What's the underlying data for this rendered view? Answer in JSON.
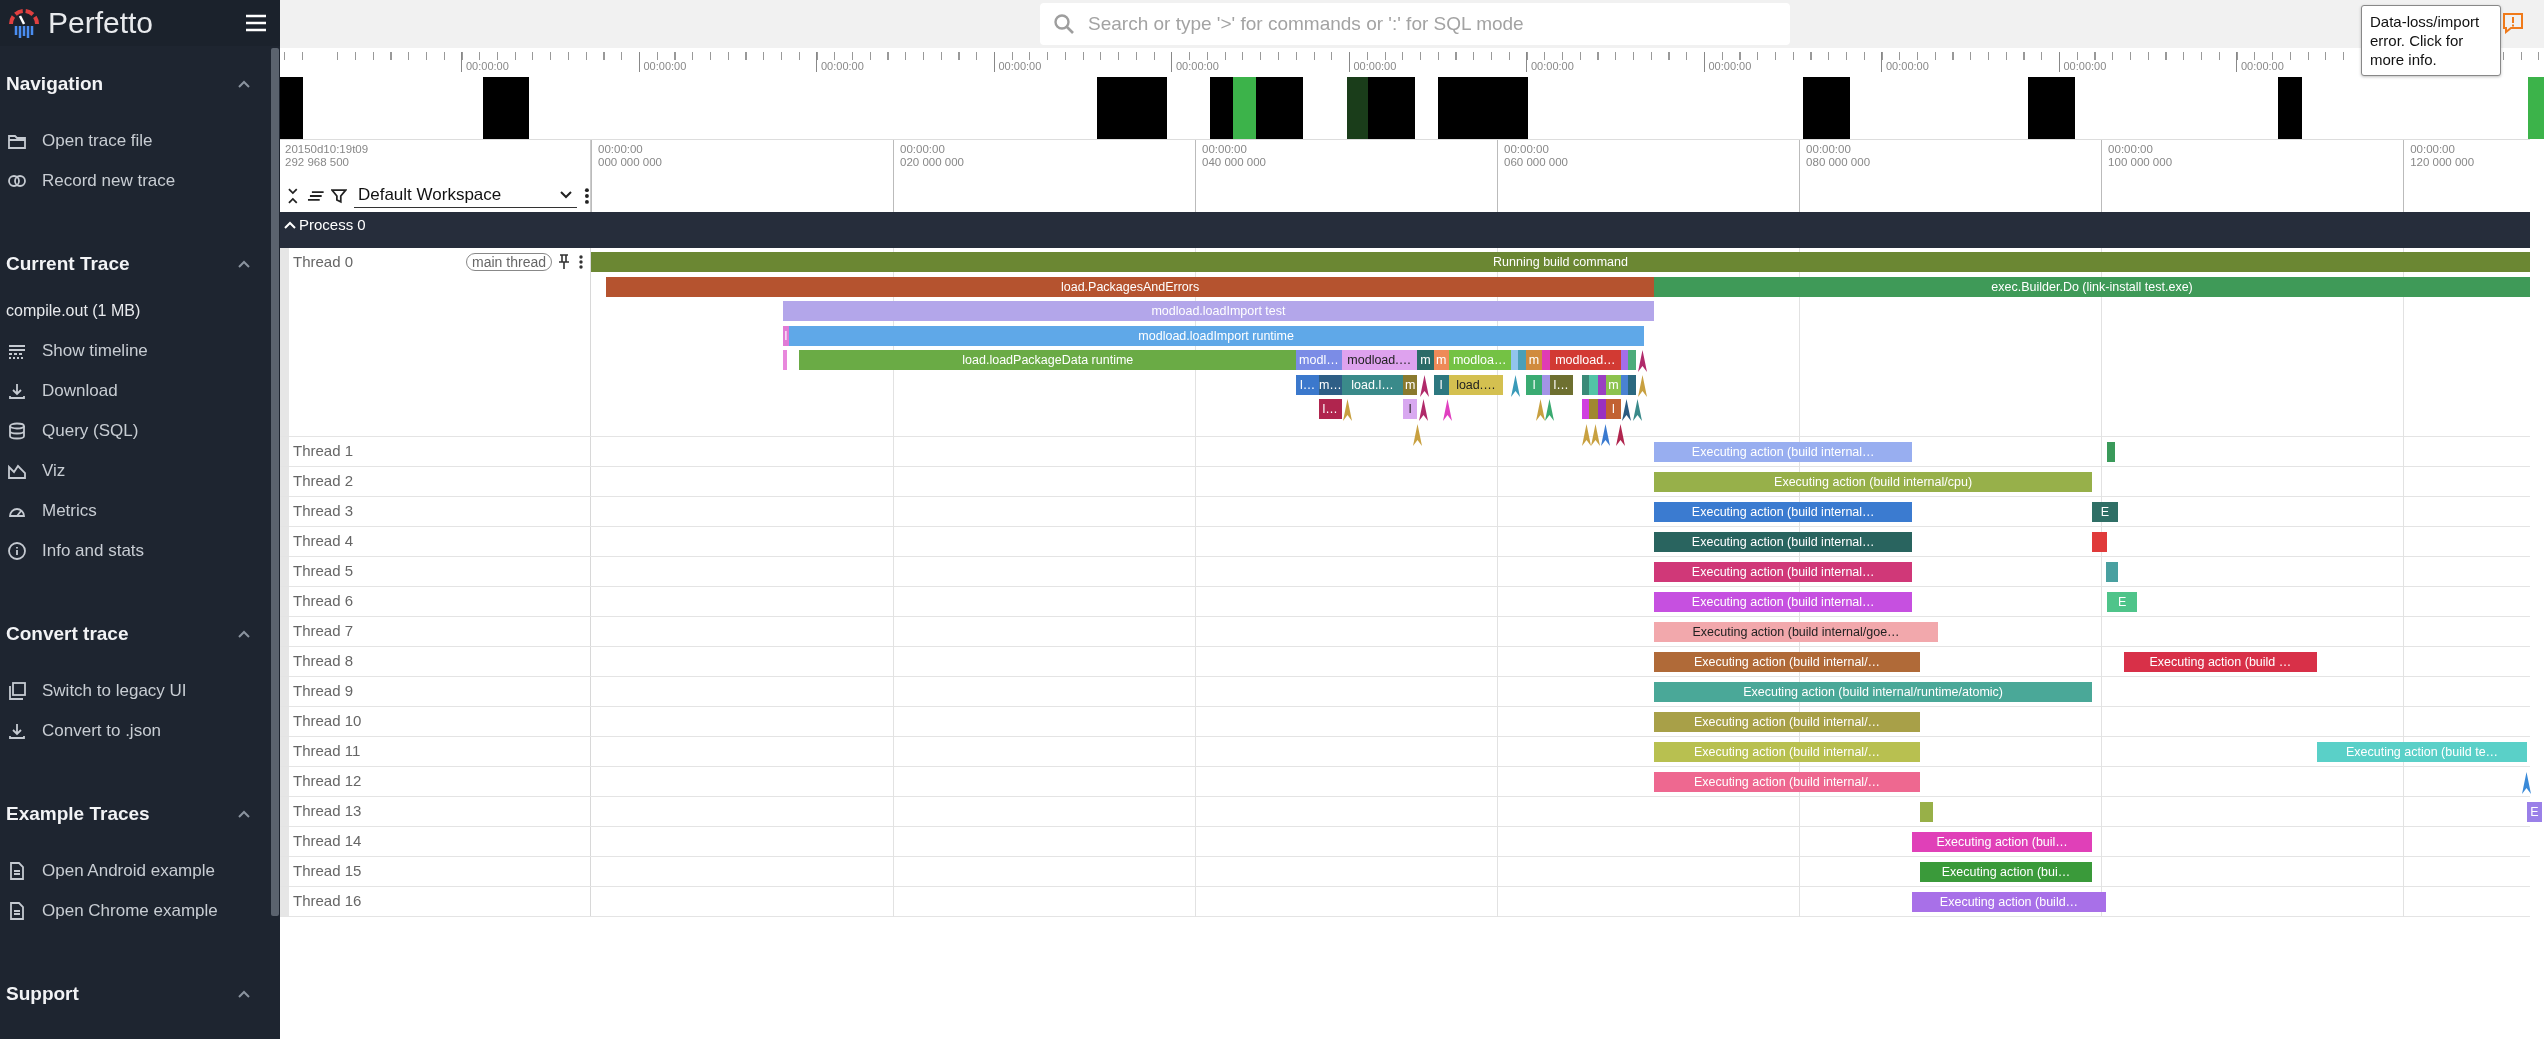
{
  "sidebar": {
    "title": "Perfetto",
    "sections": [
      {
        "title": "Navigation",
        "expanded": true,
        "items": [
          {
            "kind": "link",
            "label": "Open trace file"
          },
          {
            "kind": "link",
            "label": "Record new trace"
          }
        ]
      },
      {
        "title": "Current Trace",
        "expanded": true,
        "items": [
          {
            "kind": "text",
            "label": "compile.out (1 MB)"
          },
          {
            "kind": "link",
            "label": "Show timeline"
          },
          {
            "kind": "link",
            "label": "Download"
          },
          {
            "kind": "link",
            "label": "Query (SQL)"
          },
          {
            "kind": "link",
            "label": "Viz"
          },
          {
            "kind": "link",
            "label": "Metrics"
          },
          {
            "kind": "link",
            "label": "Info and stats"
          }
        ]
      },
      {
        "title": "Convert trace",
        "expanded": true,
        "items": [
          {
            "kind": "link",
            "label": "Switch to legacy UI"
          },
          {
            "kind": "link",
            "label": "Convert to .json"
          }
        ]
      },
      {
        "title": "Example Traces",
        "expanded": true,
        "items": [
          {
            "kind": "link",
            "label": "Open Android example"
          },
          {
            "kind": "link",
            "label": "Open Chrome example"
          }
        ]
      },
      {
        "title": "Support",
        "expanded": true
      }
    ]
  },
  "topbar": {
    "search": {
      "placeholder": "Search or type '>' for commands or ':' for SQL mode"
    },
    "error_tooltip": {
      "text": "Data-loss/import error. Click for more info."
    }
  },
  "overview": {
    "tick_labels": [
      "00:00:00",
      "00:00:00",
      "00:00:00",
      "00:00:00",
      "00:00:00",
      "00:00:00",
      "00:00:00",
      "00:00:00",
      "00:00:00",
      "00:00:00",
      "00:00:00"
    ]
  },
  "timeline": {
    "start_label": "20150d10:19t09",
    "start_offset": "292 968 500",
    "ticks": [
      {
        "time": "00:00:00",
        "offset": "000 000 000"
      },
      {
        "time": "00:00:00",
        "offset": "020 000 000"
      },
      {
        "time": "00:00:00",
        "offset": "040 000 000"
      },
      {
        "time": "00:00:00",
        "offset": "060 000 000"
      },
      {
        "time": "00:00:00",
        "offset": "080 000 000"
      },
      {
        "time": "00:00:00",
        "offset": "100 000 000"
      },
      {
        "time": "00:00:00",
        "offset": "120 000 000"
      }
    ]
  },
  "workspace": {
    "name": "Default Workspace"
  },
  "process": {
    "name": "Process 0",
    "expanded": true
  },
  "threads": [
    {
      "name": "Thread 0",
      "tag": "main thread",
      "rows": [
        {
          "slices": [
            {
              "name": "Running build command",
              "color": "#6b8733"
            }
          ]
        },
        {
          "slices": [
            {
              "name": "load.PackagesAndErrors",
              "color": "#b5532f"
            },
            {
              "name": "exec.Builder.Do (link-install test.exe)",
              "color": "#3f9a58"
            }
          ]
        },
        {
          "slices": [
            {
              "name": "modload.loadImport test",
              "color": "#b3a6ea"
            }
          ]
        },
        {
          "slices": [
            {
              "name": "l",
              "color": "#e07bd6"
            },
            {
              "name": "modload.loadImport runtime",
              "color": "#5fa8e8"
            }
          ]
        },
        {
          "slices": [
            {
              "color": "#e888dc"
            },
            {
              "name": "load.loadPackageData runtime",
              "color": "#6aab45"
            },
            {
              "name": "modl…",
              "color": "#7b8ce6"
            },
            {
              "name": "modload.…",
              "color": "#dea2ee"
            },
            {
              "name": "m",
              "color": "#2b6b68"
            },
            {
              "name": "m",
              "color": "#ee8a58"
            },
            {
              "name": "modloa…",
              "color": "#74c244"
            },
            {
              "color": "#91c4ee"
            },
            {
              "color": "#4a9fb8"
            },
            {
              "name": "m",
              "color": "#d08b3e"
            },
            {
              "color": "#e03cb4"
            },
            {
              "name": "modload…",
              "color": "#d23a33"
            },
            {
              "color": "#a56ee8"
            },
            {
              "color": "#4cac7a"
            }
          ],
          "instants": [
            {
              "color": "#b02a6a"
            }
          ]
        },
        {
          "slices": [
            {
              "name": "l…",
              "color": "#3b78cc"
            },
            {
              "name": "m…",
              "color": "#2e5e86"
            },
            {
              "name": "load.l…",
              "color": "#3a8a8a"
            },
            {
              "name": "m",
              "color": "#8a7a2e"
            },
            {
              "name": "l",
              "color": "#2d7880"
            },
            {
              "name": "load.…",
              "color": "#d4c050"
            },
            {
              "name": "l",
              "color": "#3aab72"
            },
            {
              "color": "#a394e6"
            },
            {
              "name": "l…",
              "color": "#6e7030"
            },
            {
              "color": "#3a8a78"
            },
            {
              "color": "#52c4a6"
            },
            {
              "color": "#9a40c2"
            },
            {
              "name": "m",
              "color": "#8cc24e"
            },
            {
              "color": "#4a82d2"
            },
            {
              "color": "#2a6880"
            }
          ],
          "instants": [
            {
              "color": "#b02a6a"
            },
            {
              "color": "#3a9ab8"
            },
            {
              "color": "#c8a040"
            }
          ]
        },
        {
          "slices": [
            {
              "name": "l…",
              "color": "#b0254e"
            },
            {
              "name": "l",
              "color": "#d8a8f0"
            },
            {
              "color": "#d040e0"
            },
            {
              "color": "#a08830"
            },
            {
              "color": "#9a30c0"
            },
            {
              "name": "l",
              "color": "#c26232"
            }
          ],
          "instants": [
            {
              "color": "#c8a040"
            },
            {
              "color": "#b02a6a"
            },
            {
              "color": "#e040c0"
            },
            {
              "color": "#c8a040"
            },
            {
              "color": "#3aaa70"
            },
            {
              "color": "#2a5a80"
            },
            {
              "color": "#3a8a8a"
            }
          ]
        },
        {
          "instants": [
            {
              "color": "#c8a040"
            },
            {
              "color": "#c8a040"
            },
            {
              "color": "#c8a040"
            },
            {
              "color": "#3a7ad0"
            },
            {
              "color": "#b0254e"
            }
          ]
        }
      ]
    },
    {
      "name": "Thread 1",
      "rows": [
        {
          "slices": [
            {
              "name": "Executing action (build internal…",
              "color": "#98aef0"
            },
            {
              "color": "#3a9a5a"
            }
          ]
        }
      ]
    },
    {
      "name": "Thread 2",
      "rows": [
        {
          "slices": [
            {
              "name": "Executing action (build internal/cpu)",
              "color": "#97b04a"
            }
          ]
        }
      ]
    },
    {
      "name": "Thread 3",
      "rows": [
        {
          "slices": [
            {
              "name": "Executing action (build internal…",
              "color": "#3b7bd0"
            },
            {
              "name": "E",
              "color": "#2f6f66"
            }
          ]
        }
      ]
    },
    {
      "name": "Thread 4",
      "rows": [
        {
          "slices": [
            {
              "name": "Executing action (build internal…",
              "color": "#29645f"
            },
            {
              "color": "#e03a3a"
            }
          ]
        }
      ]
    },
    {
      "name": "Thread 5",
      "rows": [
        {
          "slices": [
            {
              "name": "Executing action (build internal…",
              "color": "#d03878"
            },
            {
              "color": "#49a0a0"
            }
          ]
        }
      ]
    },
    {
      "name": "Thread 6",
      "rows": [
        {
          "slices": [
            {
              "name": "Executing action (build internal…",
              "color": "#c650e0"
            },
            {
              "name": "E",
              "color": "#4fc48a"
            }
          ]
        }
      ]
    },
    {
      "name": "Thread 7",
      "rows": [
        {
          "slices": [
            {
              "name": "Executing action (build internal/goe…",
              "color": "#f2a8ac"
            }
          ]
        }
      ]
    },
    {
      "name": "Thread 8",
      "rows": [
        {
          "slices": [
            {
              "name": "Executing action (build internal/…",
              "color": "#b06a38"
            },
            {
              "name": "Executing action (build …",
              "color": "#d83048"
            }
          ]
        }
      ]
    },
    {
      "name": "Thread 9",
      "rows": [
        {
          "slices": [
            {
              "name": "Executing action (build internal/runtime/atomic)",
              "color": "#4aa898"
            }
          ]
        }
      ]
    },
    {
      "name": "Thread 10",
      "rows": [
        {
          "slices": [
            {
              "name": "Executing action (build internal/…",
              "color": "#a8a048"
            }
          ]
        }
      ]
    },
    {
      "name": "Thread 11",
      "rows": [
        {
          "slices": [
            {
              "name": "Executing action (build internal/…",
              "color": "#b8c050"
            },
            {
              "name": "Executing action (build te…",
              "color": "#5ad0c8"
            }
          ]
        }
      ]
    },
    {
      "name": "Thread 12",
      "rows": [
        {
          "slices": [
            {
              "name": "Executing action (build internal/…",
              "color": "#ee6890"
            }
          ],
          "instants": [
            {
              "color": "#3a8ad8"
            }
          ]
        }
      ]
    },
    {
      "name": "Thread 13",
      "rows": [
        {
          "slices": [
            {
              "color": "#98b048"
            },
            {
              "name": "E",
              "color": "#9a80e8"
            }
          ]
        }
      ]
    },
    {
      "name": "Thread 14",
      "rows": [
        {
          "slices": [
            {
              "name": "Executing action (buil…",
              "color": "#e040b8"
            }
          ]
        }
      ]
    },
    {
      "name": "Thread 15",
      "rows": [
        {
          "slices": [
            {
              "name": "Executing action (bui…",
              "color": "#3a9a3a"
            }
          ]
        }
      ]
    },
    {
      "name": "Thread 16",
      "rows": [
        {
          "slices": [
            {
              "name": "Executing action (build…",
              "color": "#a870e8"
            }
          ]
        }
      ]
    }
  ]
}
